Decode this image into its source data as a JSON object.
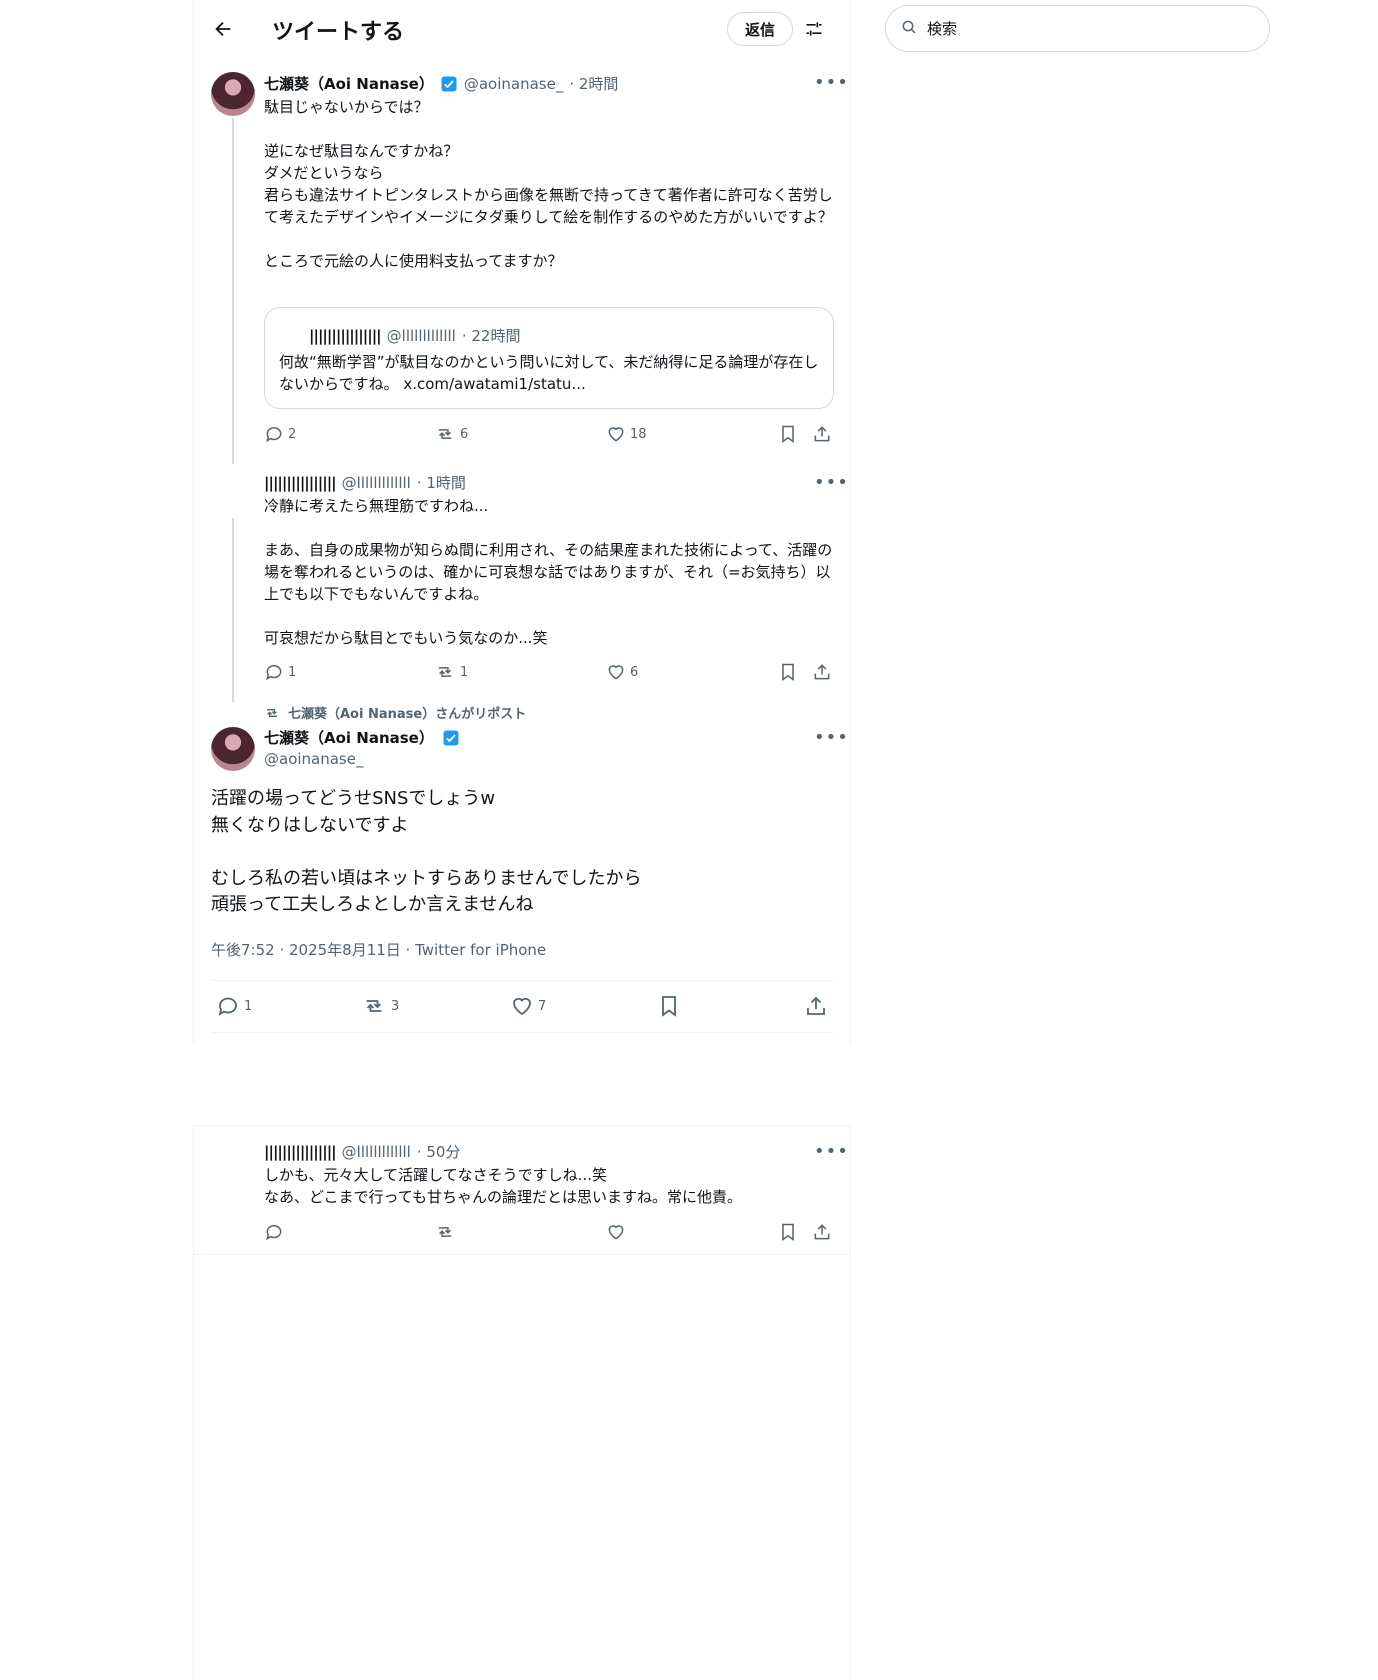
{
  "header": {
    "title": "ツイートする",
    "reply_label": "返信"
  },
  "search": {
    "placeholder": "検索"
  },
  "tweet1": {
    "name": "七瀬葵（Aoi Nanase）",
    "handle": "@aoinanase_",
    "time": "· 2時間",
    "text": "駄目じゃないからでは？\n\n逆になぜ駄目なんですかね？\nダメだというなら\n君らも違法サイトピンタレストから画像を無断で持ってきて著作者に許可なく苦労して考えたデザインやイメージにタダ乗りして絵を制作するのやめた方がいいですよ？\n\nところで元絵の人に使用料支払ってますか？",
    "quote": {
      "name": "||||||||||||||||",
      "handle": "@lllllllllllll",
      "time": "· 22時間",
      "text": "何故“無断学習”が駄目なのかという問いに対して、未だ納得に足る論理が存在しないからですね。 x.com/awatami1/statu..."
    },
    "replies": "2",
    "reposts": "6",
    "likes": "18"
  },
  "tweet2": {
    "name": "||||||||||||||||",
    "handle": "@lllllllllllll",
    "time": "· 1時間",
    "text": "冷静に考えたら無理筋ですわね...\n\nまあ、自身の成果物が知らぬ間に利用され、その結果産まれた技術によって、活躍の場を奪われるというのは、確かに可哀想な話ではありますが、それ（=お気持ち）以上でも以下でもないんですよね。\n\n可哀想だから駄目とでもいう気なのか...笑",
    "replies": "1",
    "reposts": "1",
    "likes": "6"
  },
  "main": {
    "repost_label": "七瀬葵（Aoi Nanase）さんがリポスト",
    "name": "七瀬葵（Aoi Nanase）",
    "handle": "@aoinanase_",
    "text": "活躍の場ってどうせSNSでしょうw\n無くなりはしないですよ\n\nむしろ私の若い頃はネットすらありませんでしたから\n頑張って工夫しろよとしか言えませんね",
    "timestamp": "午後7:52 · 2025年8月11日 · Twitter for iPhone",
    "replies": "1",
    "reposts": "3",
    "likes": "7"
  },
  "tweet3": {
    "name": "||||||||||||||||",
    "handle": "@lllllllllllll",
    "time": "· 50分",
    "text": "しかも、元々大して活躍してなさそうですしね...笑\nなあ、どこまで行っても甘ちゃんの論理だとは思いますね。常に他責。"
  },
  "colors": {
    "verified_blue": "#1d9bf0",
    "secondary_text": "#536471",
    "border": "#cfd9de"
  },
  "icons": [
    "back-arrow-icon",
    "filter-icon",
    "search-icon",
    "verified-icon",
    "more-icon",
    "reply-icon",
    "repost-icon",
    "like-icon",
    "bookmark-icon",
    "share-icon"
  ]
}
